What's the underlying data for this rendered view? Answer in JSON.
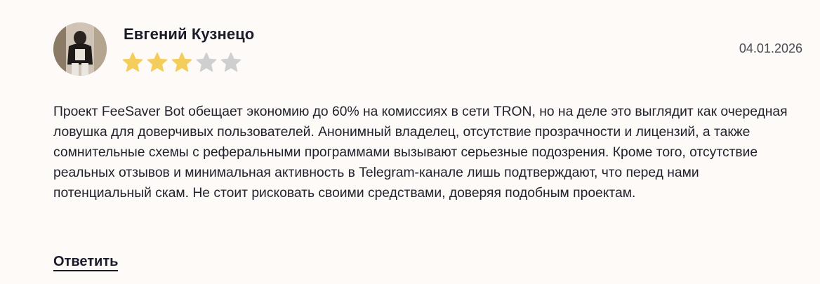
{
  "review": {
    "author": "Евгений Кузнецо",
    "date": "04.01.2026",
    "rating": 3,
    "rating_max": 5,
    "text": "Проект FeeSaver Bot обещает экономию до 60% на комиссиях в сети TRON, но на деле это выглядит как очередная ловушка для доверчивых пользователей. Анонимный владелец, отсутствие прозрачности и лицензий, а также сомнительные схемы с реферальными программами вызывают серьезные подозрения. Кроме того, отсутствие реальных отзывов и минимальная активность в Telegram-канале лишь подтверждают, что перед нами потенциальный скам. Не стоит рисковать своими средствами, доверяя подобным проектам.",
    "reply_label": "Ответить"
  },
  "colors": {
    "star_filled": "#f5cd5c",
    "star_empty": "#cfcfcf",
    "background": "#fdfaf7"
  },
  "icons": {
    "avatar": "user-photo-avatar",
    "star": "star-icon"
  }
}
